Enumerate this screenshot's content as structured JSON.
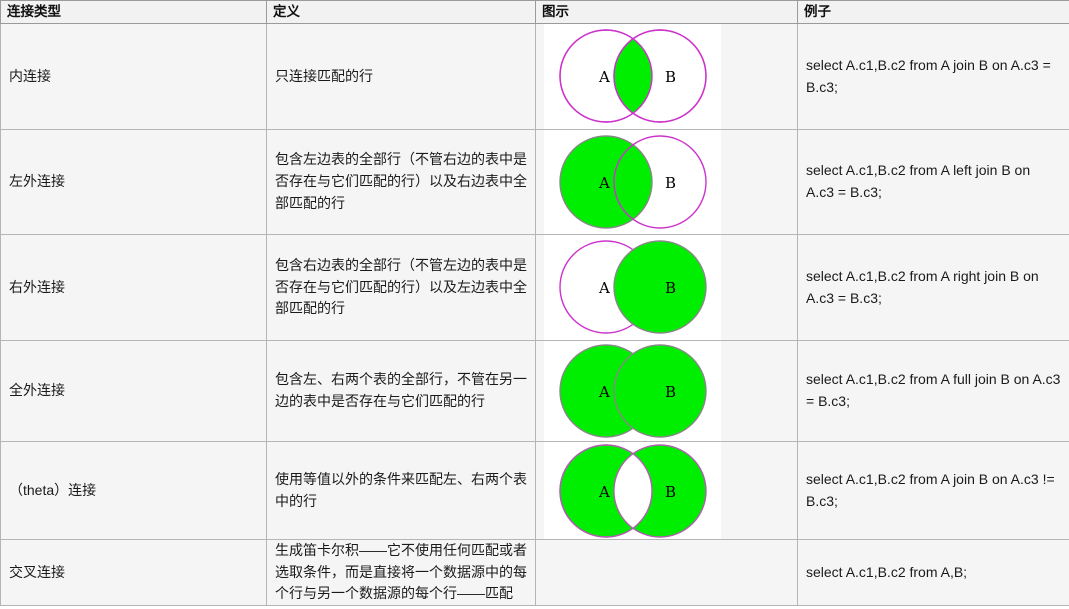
{
  "table": {
    "headers": {
      "type": "连接类型",
      "definition": "定义",
      "diagram": "图示",
      "example": "例子"
    },
    "rows": [
      {
        "type": "内连接",
        "definition": "只连接匹配的行",
        "diagram": {
          "label_a": "A",
          "label_b": "B",
          "fill_a": false,
          "fill_b": false,
          "fill_overlap": true,
          "stroke": "#cc33cc",
          "green": "#00ee00"
        },
        "example": "select A.c1,B.c2 from A join B on A.c3 = B.c3;"
      },
      {
        "type": "左外连接",
        "definition": "包含左边表的全部行（不管右边的表中是否存在与它们匹配的行）以及右边表中全部匹配的行",
        "diagram": {
          "label_a": "A",
          "label_b": "B",
          "fill_a": true,
          "fill_b": false,
          "fill_overlap": true,
          "stroke": "#cc33cc",
          "green": "#00ee00"
        },
        "example": "select A.c1,B.c2 from A left join B on A.c3 = B.c3;"
      },
      {
        "type": "右外连接",
        "definition": "包含右边表的全部行（不管左边的表中是否存在与它们匹配的行）以及左边表中全部匹配的行",
        "diagram": {
          "label_a": "A",
          "label_b": "B",
          "fill_a": false,
          "fill_b": true,
          "fill_overlap": true,
          "stroke": "#cc33cc",
          "green": "#00ee00"
        },
        "example": "select A.c1,B.c2 from A right join B on A.c3 = B.c3;"
      },
      {
        "type": "全外连接",
        "definition": "包含左、右两个表的全部行，不管在另一边的表中是否存在与它们匹配的行",
        "diagram": {
          "label_a": "A",
          "label_b": "B",
          "fill_a": true,
          "fill_b": true,
          "fill_overlap": true,
          "stroke": "#888888",
          "green": "#00ee00"
        },
        "example": "select A.c1,B.c2 from A full join B on A.c3 = B.c3;"
      },
      {
        "type": "（theta）连接",
        "definition": "使用等值以外的条件来匹配左、右两个表中的行",
        "diagram": {
          "label_a": "A",
          "label_b": "B",
          "fill_a": true,
          "fill_b": true,
          "fill_overlap": false,
          "stroke": "#b060b0",
          "green": "#00ee00"
        },
        "example": "select A.c1,B.c2 from A join B on A.c3 != B.c3;"
      },
      {
        "type": "交叉连接",
        "definition": "生成笛卡尔积——它不使用任何匹配或者选取条件，而是直接将一个数据源中的每个行与另一个数据源的每个行——匹配",
        "diagram": null,
        "example": "select A.c1,B.c2 from A,B;"
      }
    ]
  }
}
